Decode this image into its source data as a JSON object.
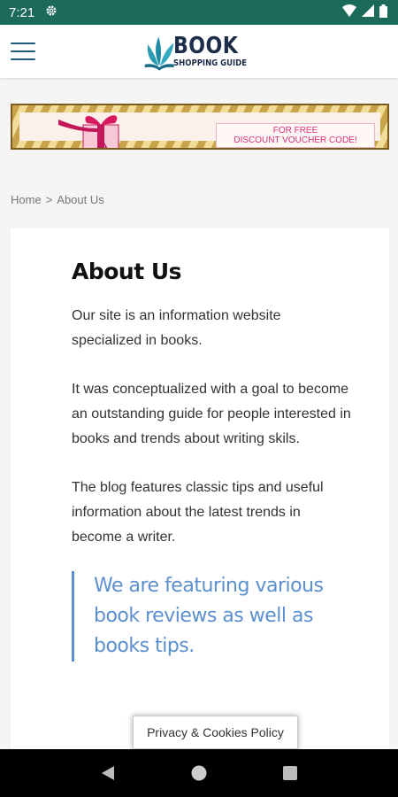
{
  "status_bar": {
    "time": "7:21",
    "icons": [
      "settings-gear-icon",
      "wifi-icon",
      "signal-icon",
      "battery-icon"
    ]
  },
  "header": {
    "logo_title": "BOOK",
    "logo_subtitle": "SHOPPING GUIDE",
    "menu_icon": "hamburger-menu-icon"
  },
  "banner": {
    "line1": "FOR FREE",
    "line2": "DISCOUNT VOUCHER CODE!",
    "image": "gift-box-icon"
  },
  "breadcrumb": {
    "home": "Home",
    "separator": ">",
    "current": "About Us"
  },
  "content": {
    "title": "About Us",
    "paragraphs": [
      "Our site is an information website specialized in books.",
      "It was conceptualized with a goal to become an outstanding guide for people interested in books and trends about writing skils.",
      "The blog features classic tips and useful information about the latest trends in become a writer."
    ],
    "quote": "We are featuring various book reviews as well as books tips."
  },
  "cookie_button": {
    "label": "Privacy & Cookies Policy"
  },
  "nav_bar": {
    "icons": [
      "back-icon",
      "home-icon",
      "recents-icon"
    ]
  },
  "colors": {
    "status_bar": "#1c6b5a",
    "accent_blue": "#5b8fce",
    "logo_navy": "#1d2c48",
    "banner_pink": "#d9307a"
  }
}
